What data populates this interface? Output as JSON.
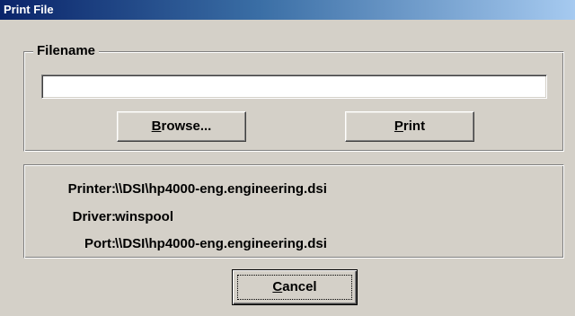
{
  "window": {
    "title": "Print File"
  },
  "filename_group": {
    "legend": "Filename",
    "input_value": "",
    "input_placeholder": ""
  },
  "buttons": {
    "browse_accel": "B",
    "browse_rest": "rowse...",
    "print_accel": "P",
    "print_rest": "rint",
    "cancel_accel": "C",
    "cancel_rest": "ancel"
  },
  "info": {
    "printer_label": "Printer:",
    "printer_value": "\\\\DSI\\hp4000-eng.engineering.dsi",
    "driver_label": "Driver:",
    "driver_value": "winspool",
    "port_label": "Port:",
    "port_value": "\\\\DSI\\hp4000-eng.engineering.dsi"
  },
  "colors": {
    "title_start": "#0a246a",
    "title_end": "#a6caf0",
    "face": "#d4d0c8"
  }
}
